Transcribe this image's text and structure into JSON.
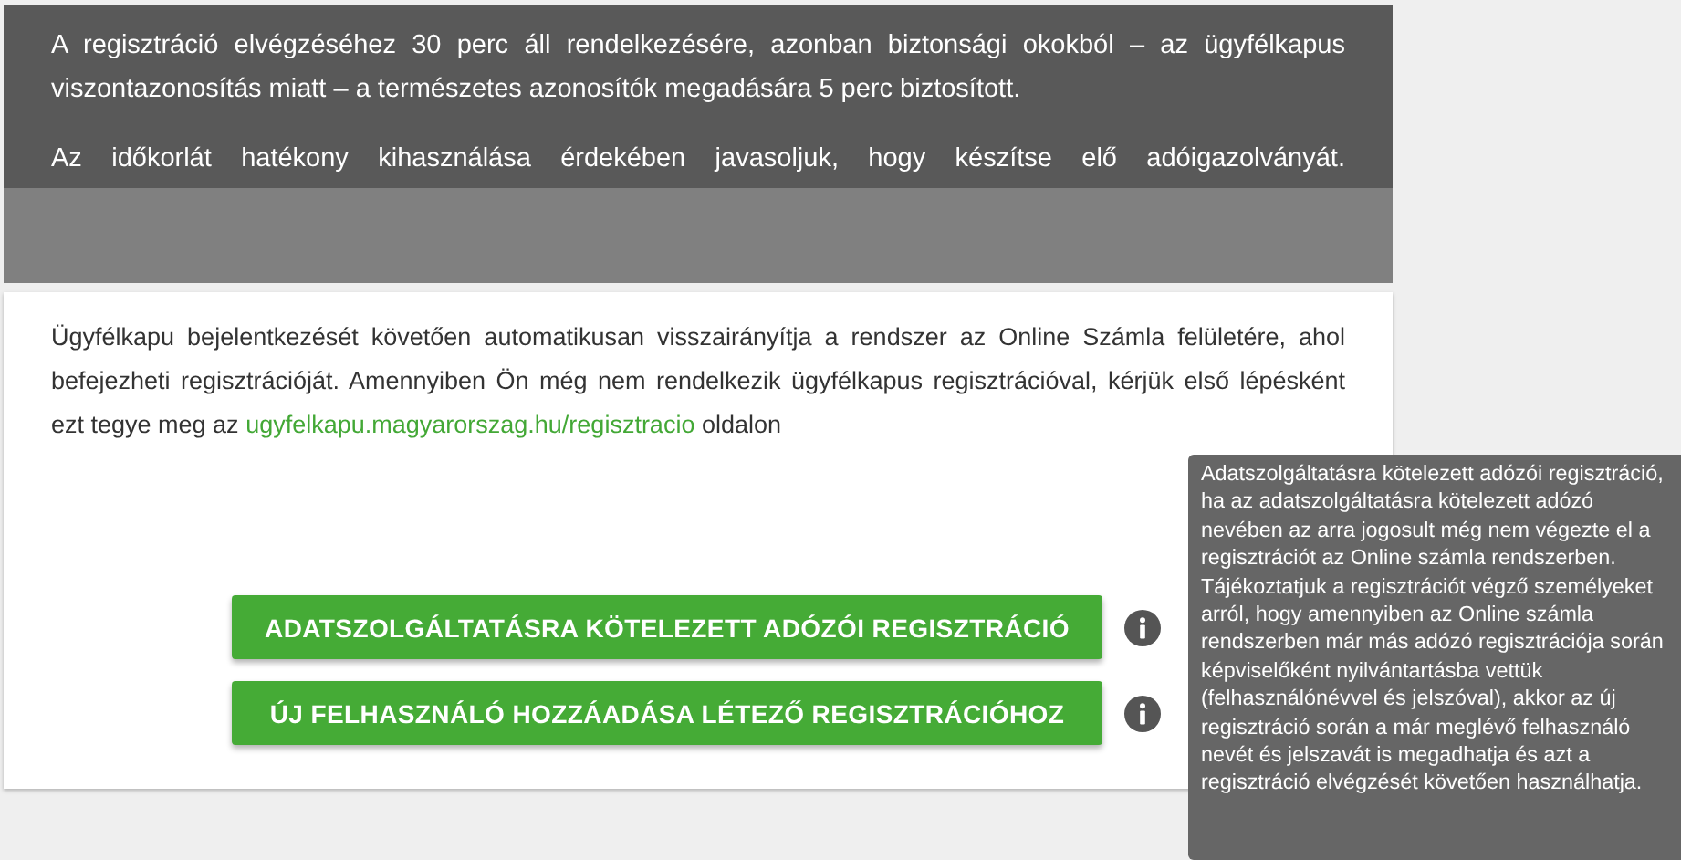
{
  "notice": {
    "paragraphs": [
      "A regisztráció elvégzéséhez 30 perc áll rendelkezésére, azonban biztonsági okokból – az ügyfélkapus viszontazonosítás miatt – a természetes azonosítók megadására 5 perc biztosított.",
      "Az időkorlát hatékony kihasználása érdekében javasoljuk, hogy készítse elő adóigazolványát."
    ]
  },
  "card": {
    "text_before": "Ügyfélkapu bejelentkezését követően automatikusan visszairányítja a rendszer az Online Számla felületére, ahol befejezheti regisztrációját. Amennyiben Ön még nem rendelkezik ügyfélkapus regisztrációval, kérjük első lépésként ezt tegye meg az",
    "link": "ugyfelkapu.magyarorszag.hu/regisztracio",
    "text_after": "oldalon",
    "buttons": [
      {
        "label": "ADATSZOLGÁLTATÁSRA KÖTELEZETT ADÓZÓI REGISZTRÁCIÓ"
      },
      {
        "label": "ÚJ FELHASZNÁLÓ HOZZÁADÁSA LÉTEZŐ REGISZTRÁCIÓHOZ"
      }
    ]
  },
  "tooltip": {
    "text": "Adatszolgáltatásra kötelezett adózói regisztráció, ha az adatszolgáltatásra kötelezett adózó nevében az arra jogosult még nem végezte el a regisztrációt az Online számla rendszerben. Tájékoztatjuk a regisztrációt végző személyeket arról, hogy amennyiben az Online számla rendszerben már más adózó regisztrációja során képviselőként nyilvántartásba vettük (felhasználónévvel és jelszóval), akkor az új regisztráció során a már meglévő felhasználó nevét és jelszavát is megadhatja és azt a regisztráció elvégzését követően használhatja."
  }
}
